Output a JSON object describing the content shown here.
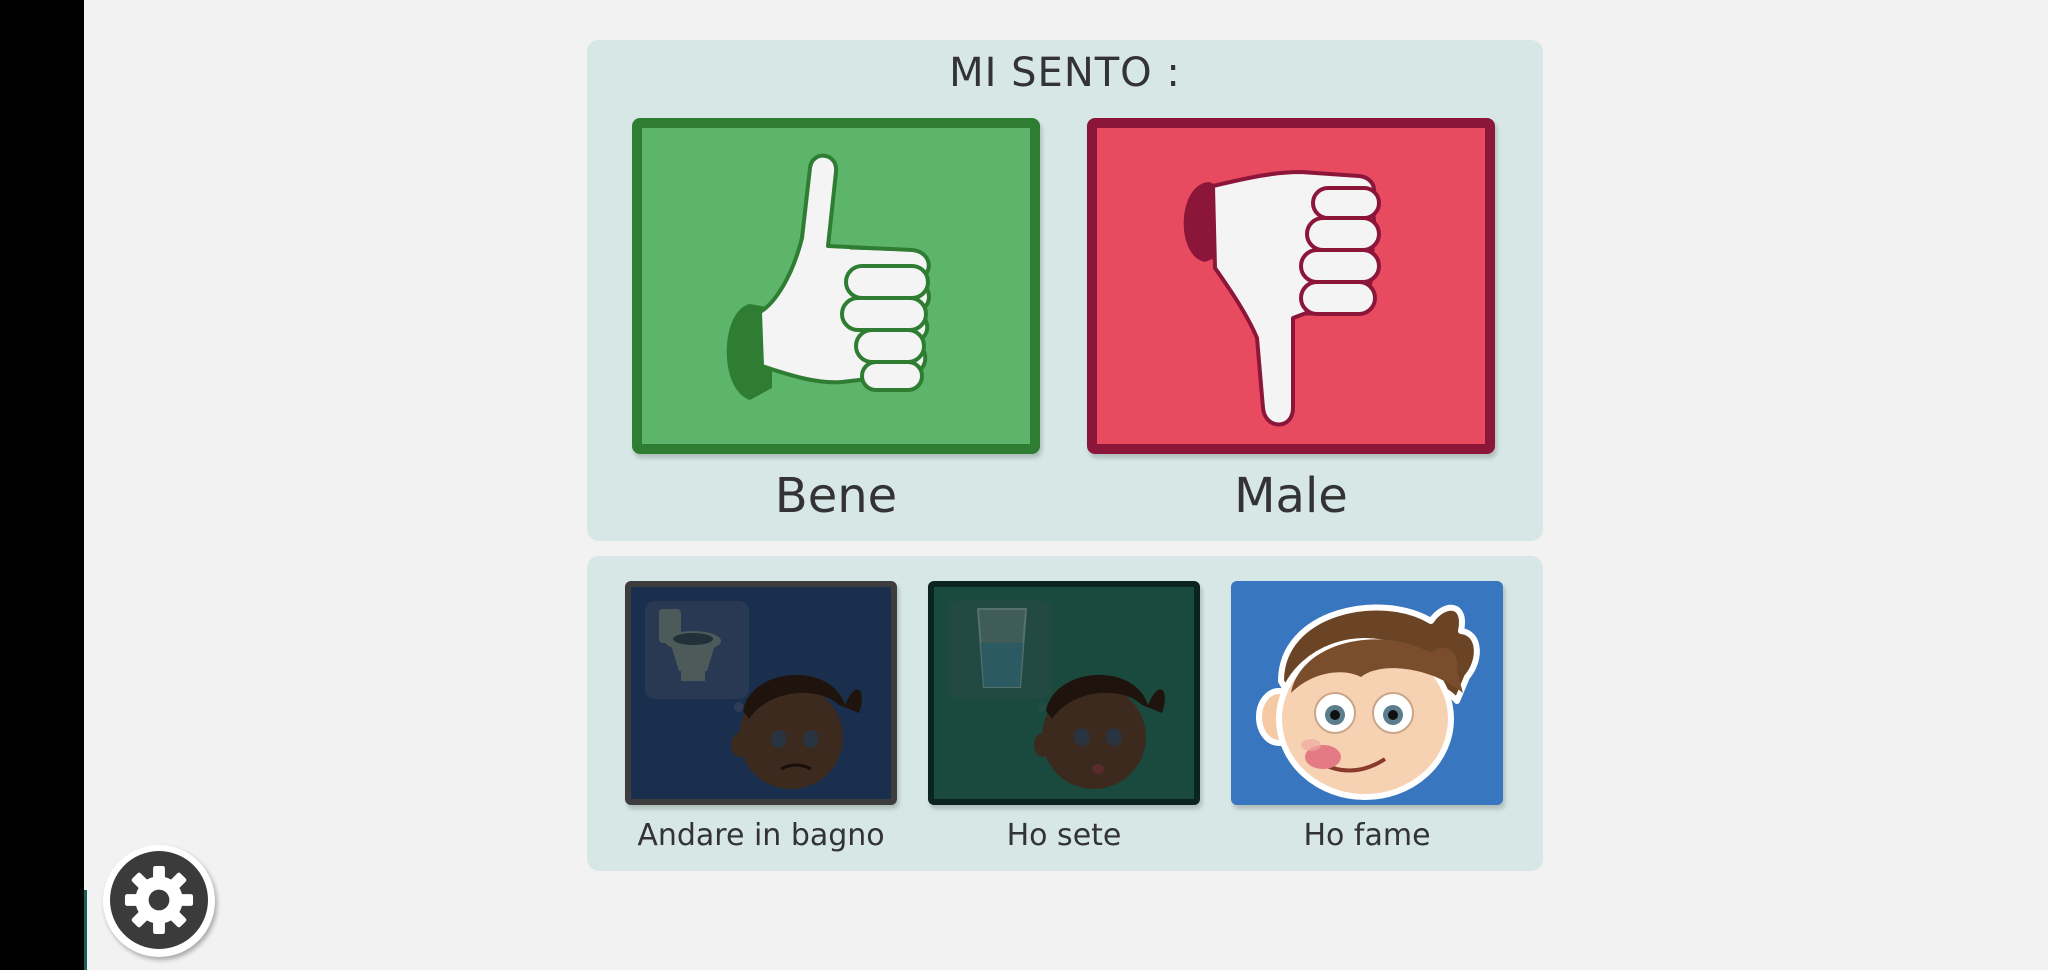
{
  "feelings": {
    "title": "MI SENTO :",
    "good": {
      "label": "Bene",
      "icon": "thumbs-up-icon",
      "color": "#5cb56a",
      "border_color": "#2e7d32"
    },
    "bad": {
      "label": "Male",
      "icon": "thumbs-down-icon",
      "color": "#e84a60",
      "border_color": "#8b163a"
    }
  },
  "needs": [
    {
      "label": "Andare in bagno",
      "icon": "toilet-icon",
      "color": "#1a2e4e"
    },
    {
      "label": "Ho sete",
      "icon": "glass-of-water-icon",
      "color": "#1a4a3e"
    },
    {
      "label": "Ho fame",
      "icon": "hungry-face-icon",
      "color": "#3877c0"
    }
  ],
  "settings": {
    "icon": "gear-icon"
  },
  "colors": {
    "background": "#f2f2f2",
    "panel": "#d6e7e6",
    "text": "#333333"
  }
}
